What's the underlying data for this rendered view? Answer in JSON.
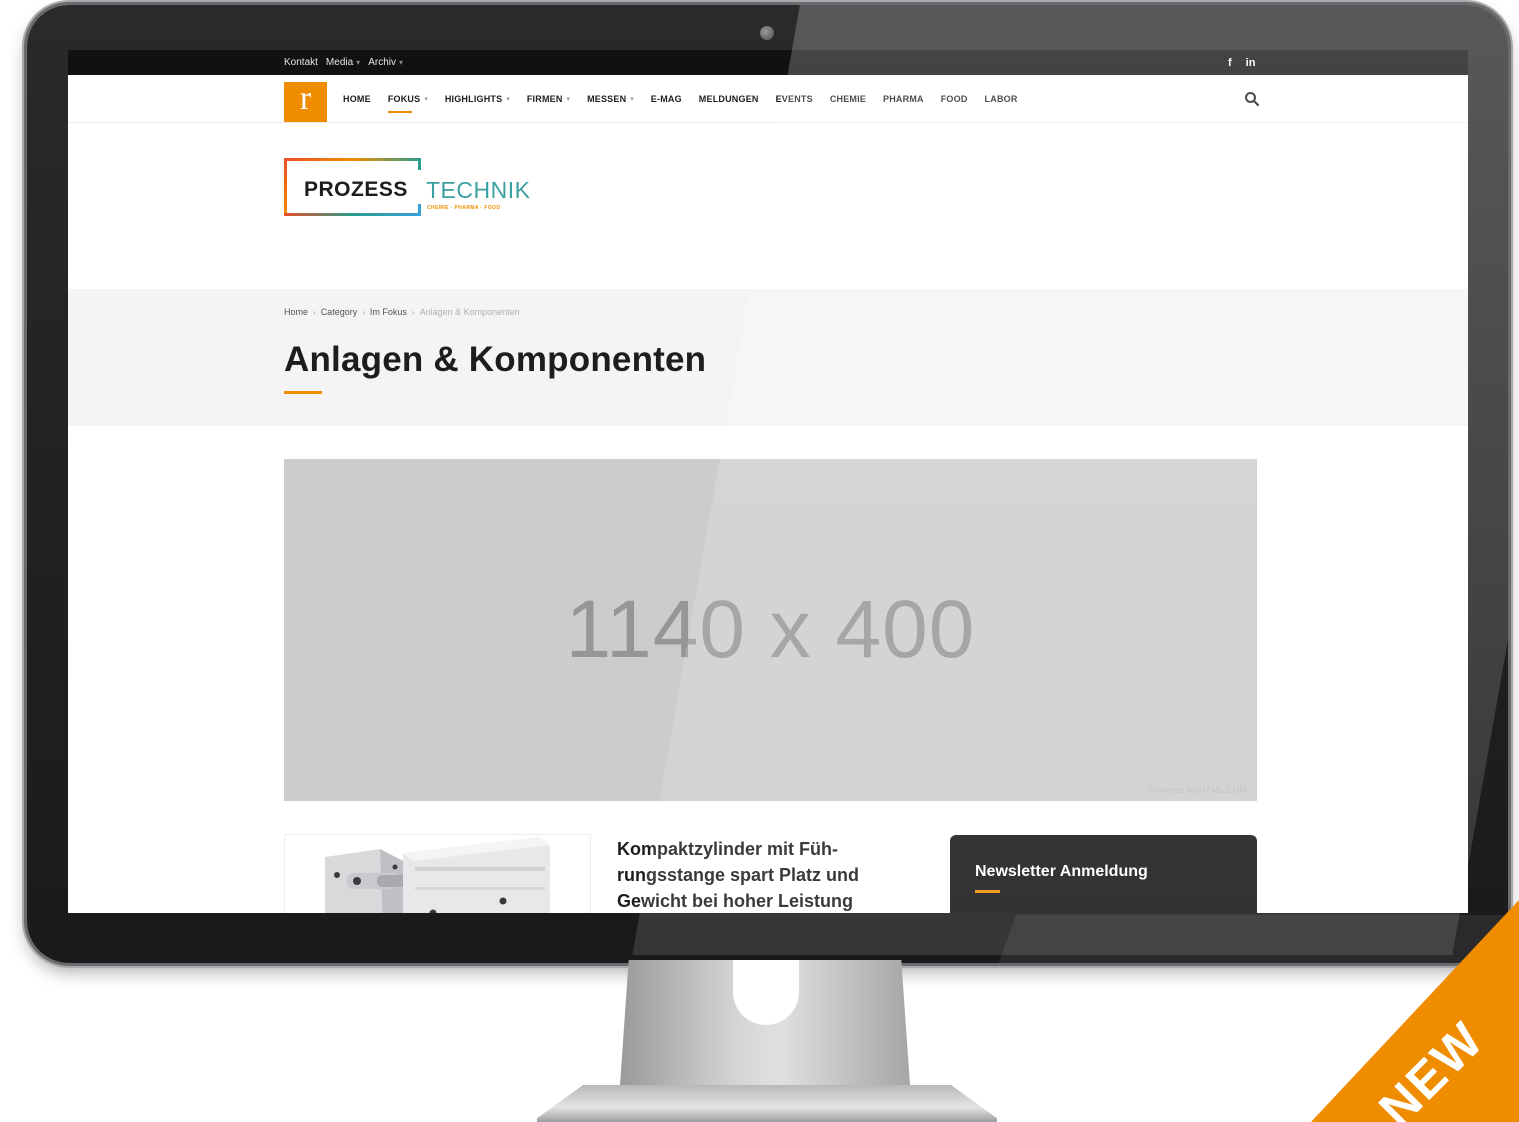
{
  "topbar": {
    "links": [
      "Kontakt",
      "Media",
      "Archiv"
    ],
    "social": [
      "f",
      "in"
    ]
  },
  "nav": {
    "logo_letter": "r",
    "items": [
      {
        "label": "HOME"
      },
      {
        "label": "FOKUS"
      },
      {
        "label": "HIGHLIGHTS"
      },
      {
        "label": "FIRMEN"
      },
      {
        "label": "MESSEN"
      },
      {
        "label": "E-MAG"
      },
      {
        "label": "MELDUNGEN"
      },
      {
        "label": "EVENTS"
      },
      {
        "label": "CHEMIE"
      },
      {
        "label": "PHARMA"
      },
      {
        "label": "FOOD"
      },
      {
        "label": "LABOR"
      }
    ]
  },
  "brand": {
    "word1": "PROZESS",
    "word2": "TECHNIK",
    "tagline": "CHEMIE · PHARMA · FOOD"
  },
  "breadcrumb": {
    "items": [
      "Home",
      "Category",
      "Im Fokus"
    ],
    "current": "Anlagen & Komponenten"
  },
  "page": {
    "title": "Anlagen & Komponenten"
  },
  "banner": {
    "dimensions": "1140 x 400",
    "credit": "Powered by HTML.COM"
  },
  "article": {
    "title": "Kompaktzylinder mit Füh-rungsstange spart Platz und Gewicht bei hoher Leistung"
  },
  "newsletter": {
    "title": "Newsletter Anmeldung"
  },
  "ribbon": {
    "text": "NEW"
  },
  "colors": {
    "accent": "#f08c00",
    "dark": "#111113",
    "banner_bg": "#cccccc"
  }
}
